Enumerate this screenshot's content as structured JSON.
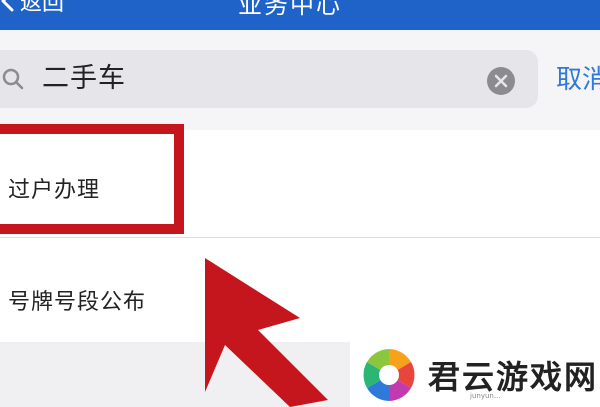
{
  "nav": {
    "back_label": "返回",
    "title": "业务中心"
  },
  "search": {
    "value": "二手车",
    "cancel_label": "取消"
  },
  "results": [
    {
      "label": "过户办理"
    },
    {
      "label": "号牌号段公布"
    }
  ],
  "annotation": {
    "color": "#c4161c"
  },
  "watermark": {
    "text": "君云游戏网",
    "subtext": "junyun..."
  },
  "colors": {
    "nav": "#1f63c9",
    "link": "#2f7ad8"
  }
}
